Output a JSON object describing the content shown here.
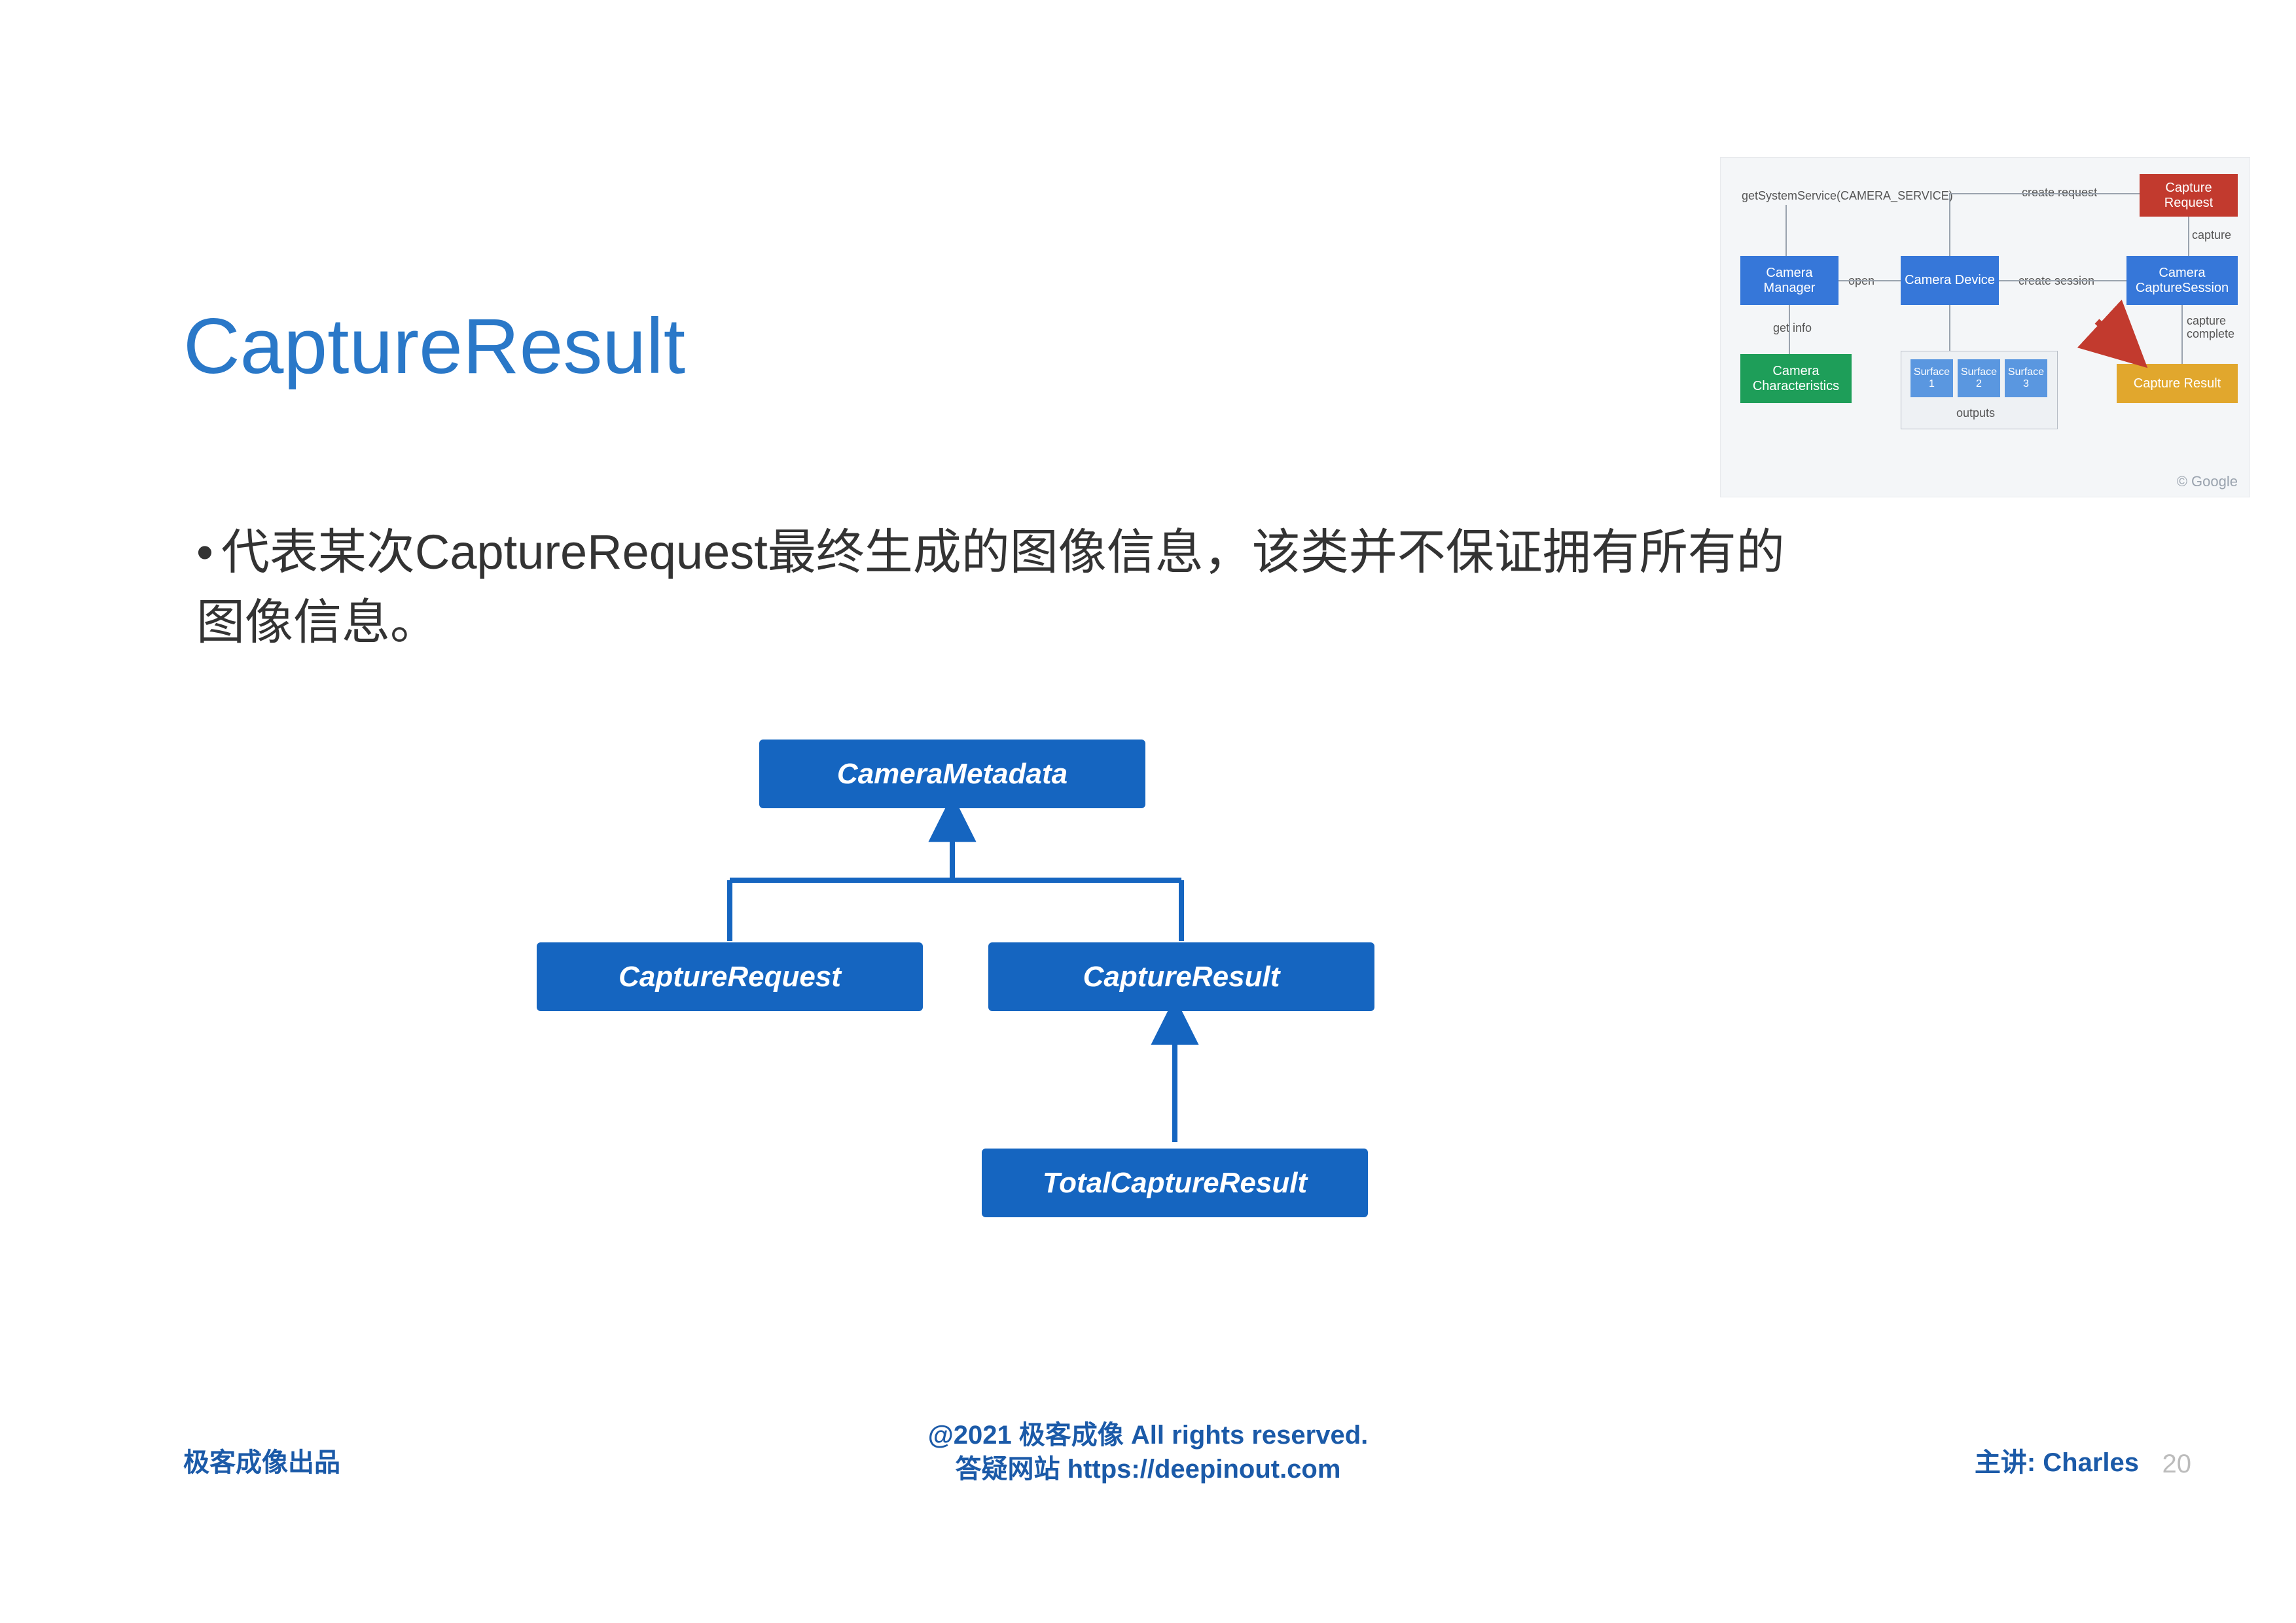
{
  "title": "CaptureResult",
  "bullet": "代表某次CaptureRequest最终生成的图像信息，该类并不保证拥有所有的图像信息。",
  "diagram": {
    "camera_metadata": "CameraMetadata",
    "capture_request": "CaptureRequest",
    "capture_result": "CaptureResult",
    "total_capture_result": "TotalCaptureResult"
  },
  "thumbnail": {
    "get_system_service": "getSystemService(CAMERA_SERVICE)",
    "camera_manager": "Camera\nManager",
    "camera_device": "Camera\nDevice",
    "camera_capture_session": "Camera\nCaptureSession",
    "camera_characteristics": "Camera\nCharacteristics",
    "capture_request": "Capture\nRequest",
    "capture_result": "Capture Result",
    "surface1": "Surface\n1",
    "surface2": "Surface\n2",
    "surface3": "Surface\n3",
    "outputs": "outputs",
    "open_label": "open",
    "get_info_label": "get info",
    "create_session_label": "create session",
    "create_request_label": "create request",
    "capture_label": "capture",
    "capture_complete_label": "capture\ncomplete",
    "copyright": "© Google"
  },
  "footer": {
    "left": "极客成像出品",
    "mid_line1": "@2021 极客成像 All rights reserved.",
    "mid_line2": "答疑网站 https://deepinout.com",
    "right": "主讲: Charles",
    "page": "20"
  }
}
